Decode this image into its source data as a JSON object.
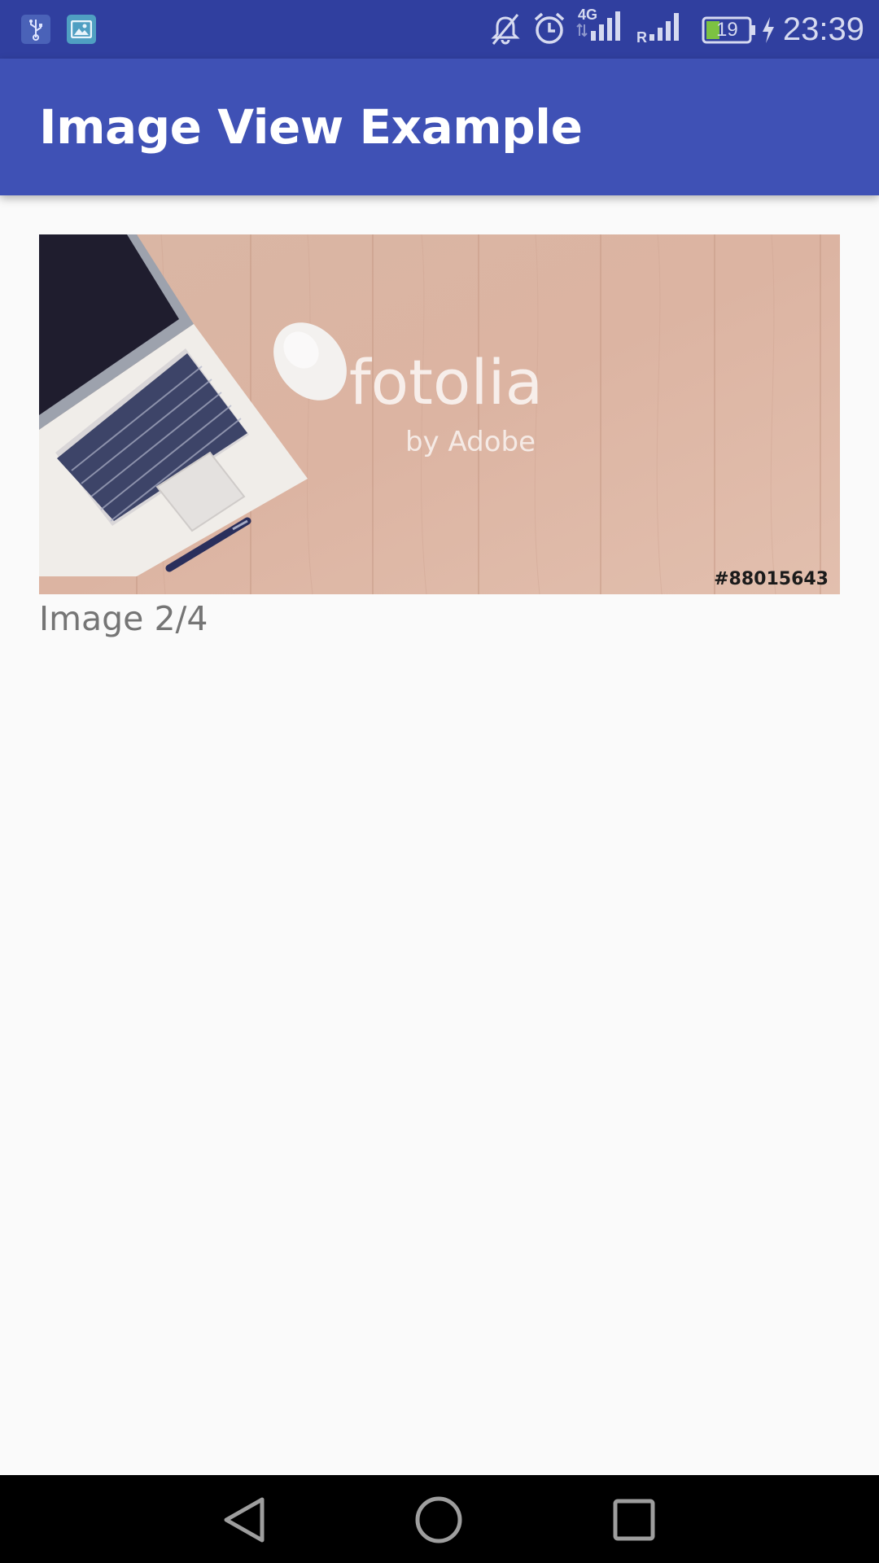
{
  "status_bar": {
    "time": "23:39",
    "battery_level": "19",
    "network_type": "4G",
    "roaming_indicator": "R",
    "icons": [
      "usb-icon",
      "gallery-notification-icon",
      "mute-icon",
      "alarm-icon",
      "signal-icon",
      "roaming-signal-icon",
      "battery-icon",
      "charging-icon"
    ]
  },
  "app_bar": {
    "title": "Image View Example"
  },
  "content": {
    "image": {
      "watermark_brand": "fotolia",
      "watermark_sub": "by Adobe",
      "stock_id": "#88015643"
    },
    "caption": "Image 2/4"
  },
  "nav_bar": {
    "icons": [
      "back-icon",
      "home-icon",
      "recents-icon"
    ]
  },
  "colors": {
    "status_bar": "#303f9f",
    "primary": "#3f51b5",
    "background": "#fafafa",
    "caption_text": "#757575",
    "nav_bar": "#000000"
  }
}
